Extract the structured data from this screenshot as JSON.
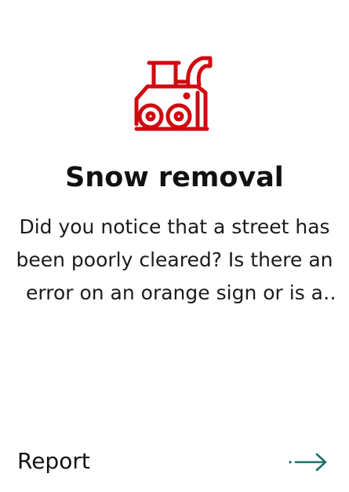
{
  "card": {
    "icon": "snowblower-icon",
    "title": "Snow removal",
    "description": "Did you notice that a street has been poorly cleared? Is there an error on an orange sign or is a sign missing?",
    "action_label": "Report",
    "action_icon": "arrow-right-icon"
  },
  "colors": {
    "icon": "#d10a11",
    "arrow": "#1c6f6a",
    "text": "#111111"
  }
}
